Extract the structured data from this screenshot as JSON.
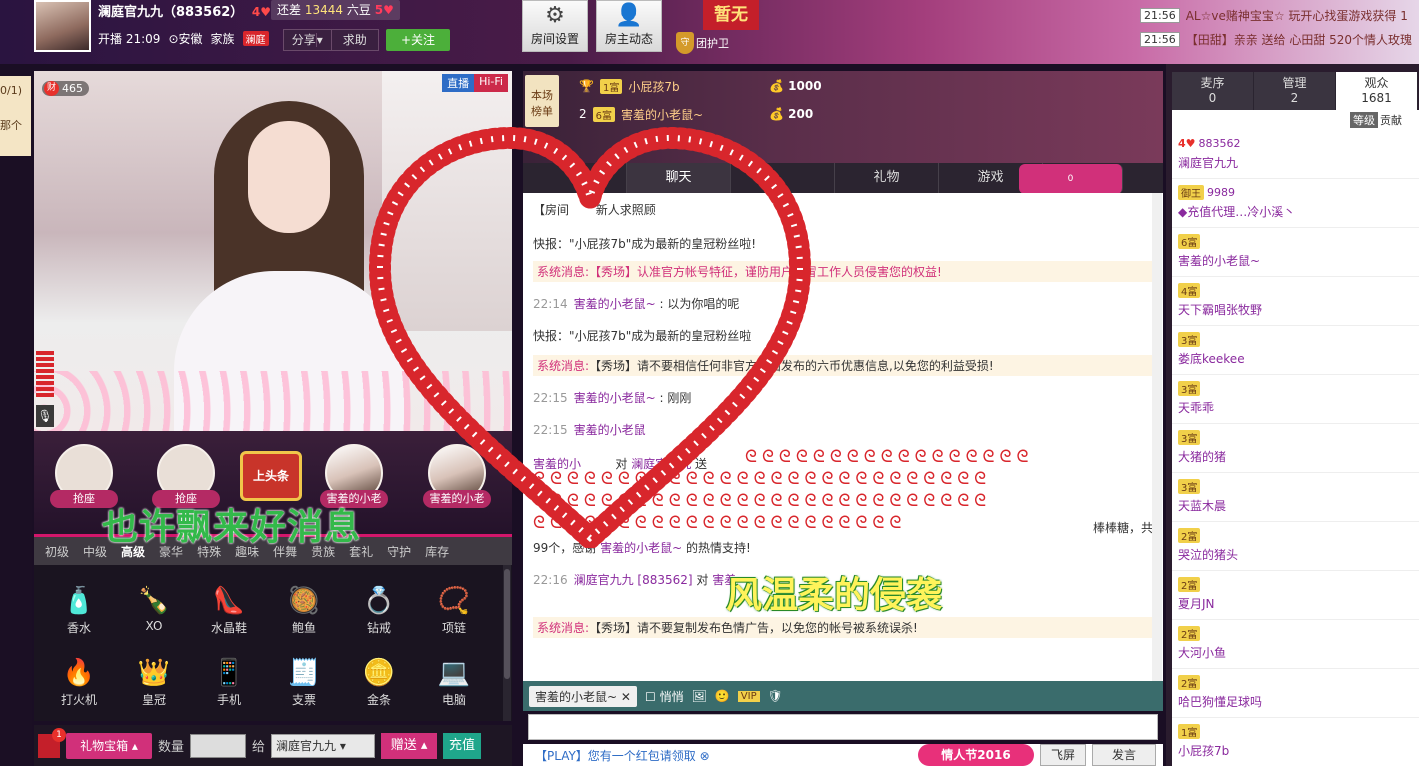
{
  "top": {
    "anchor_name": "澜庭官九九",
    "anchor_id": "（883562）",
    "anchor_level": "4",
    "gap_label": "还差",
    "gap_value": "13444",
    "gap_unit": "六豆",
    "next_level": "5",
    "start_label": "开播",
    "start_time": "21:09",
    "location": "安徽",
    "family_label": "家族",
    "family_tag": "澜庭",
    "share_label": "分享",
    "help_label": "求助",
    "follow_label": "+关注",
    "room_settings_label": "房间设置",
    "host_updates_label": "房主动态",
    "guard_label": "团护卫",
    "guard_badge": "守",
    "none_label": "暂无"
  },
  "notices": [
    {
      "time": "21:56",
      "text": "AL☆ve赌神宝宝☆ 玩开心找蛋游戏获得 1"
    },
    {
      "time": "21:56",
      "text": "【田甜】亲亲 送给 心田甜 520个情人玫瑰"
    }
  ],
  "left_tab": {
    "text1": "0/1)",
    "text2": "那个"
  },
  "video": {
    "wealth_icon": "财",
    "count": "465",
    "tag_live": "直播",
    "tag_hifi": "Hi-Fi"
  },
  "seats": [
    {
      "label": "抢座"
    },
    {
      "label": "抢座"
    },
    {
      "label": "害羞的小老"
    },
    {
      "label": "害羞的小老"
    }
  ],
  "headline_label": "上头条",
  "overlay_green": "也许飘来好消息",
  "overlay_yellow": "风温柔的侵袭",
  "gift_tabs": [
    "初级",
    "中级",
    "高级",
    "豪华",
    "特殊",
    "趣味",
    "伴舞",
    "贵族",
    "套礼",
    "守护",
    "库存"
  ],
  "gifts": [
    {
      "icon": "perfume-icon",
      "glyph": "🧴",
      "label": "香水"
    },
    {
      "icon": "xo-bottle-icon",
      "glyph": "🍾",
      "label": "XO"
    },
    {
      "icon": "crystal-shoe-icon",
      "glyph": "👠",
      "label": "水晶鞋"
    },
    {
      "icon": "abalone-icon",
      "glyph": "🥘",
      "label": "鲍鱼"
    },
    {
      "icon": "diamond-ring-icon",
      "glyph": "💍",
      "label": "钻戒"
    },
    {
      "icon": "necklace-icon",
      "glyph": "📿",
      "label": "项链"
    },
    {
      "icon": "lighter-icon",
      "glyph": "🔥",
      "label": "打火机"
    },
    {
      "icon": "crown-icon",
      "glyph": "👑",
      "label": "皇冠"
    },
    {
      "icon": "phone-icon",
      "glyph": "📱",
      "label": "手机"
    },
    {
      "icon": "check-icon",
      "glyph": "🧾",
      "label": "支票"
    },
    {
      "icon": "gold-bar-icon",
      "glyph": "🪙",
      "label": "金条"
    },
    {
      "icon": "laptop-icon",
      "glyph": "💻",
      "label": "电脑"
    }
  ],
  "gift_bottom": {
    "badge": "1",
    "box_label": "礼物宝箱",
    "qty_label": "数量",
    "to_label": "给",
    "to_value": "澜庭官九九",
    "send_label": "赠送",
    "charge_label": "充值"
  },
  "rank": {
    "badge_line1": "本场",
    "badge_line2": "榜单",
    "rows": [
      {
        "pos": "1",
        "lvl": "1富",
        "name": "小屁孩7b",
        "amt": "1000"
      },
      {
        "pos": "2",
        "lvl": "6富",
        "name": "害羞的小老鼠~",
        "amt": "200"
      }
    ]
  },
  "chat_tabs": [
    "",
    "聊天",
    "",
    "礼物",
    "游戏"
  ],
  "car_badge": "0",
  "chat": {
    "m1_prefix": "【房间",
    "m1_text": "新人求照顾",
    "m2": "快报：\"小屁孩7b\"成为最新的皇冠粉丝啦!",
    "m3_label": "系统消息:",
    "m3_text": "【秀场】认准官方帐号特征，谨防用户假冒工作人员侵害您的权益!",
    "m4_time": "22:14",
    "m4_user": "害羞的小老鼠~",
    "m4_text": "以为你唱的呢",
    "m5": "快报：\"小屁孩7b\"成为最新的皇冠粉丝啦",
    "m6_label": "系统消息:",
    "m6_text": "【秀场】请不要相信任何非官方页面发布的六币优惠信息,以免您的利益受损!",
    "m7_time": "22:15",
    "m7_user": "害羞的小老鼠~",
    "m7_text": "刚刚",
    "m8_time": "22:15",
    "m8_user": "害羞的小老鼠",
    "m9_user": "害羞的小",
    "m9_mid": "对",
    "m9_user2": "澜庭官九九",
    "m9_send": "送",
    "m10_tail": "棒棒糖，共",
    "m11_pre": "99个，感谢",
    "m11_user": "害羞的小老鼠~",
    "m11_post": "的热情支持!",
    "m12_time": "22:16",
    "m12_user": "澜庭官九九 [883562]",
    "m12_mid": "对",
    "m12_user2": "害羞",
    "m13_label": "系统消息:",
    "m13_text": "【秀场】请不要复制发布色情广告，以免您的帐号被系统误杀!"
  },
  "input_bar": {
    "to_chip": "害羞的小老鼠~",
    "private_label": "悄悄",
    "vip_label": "VIP"
  },
  "bottom": {
    "play_text": "【PLAY】您有一个红包请领取",
    "valentine": "情人节2016",
    "fly_label": "飞屏",
    "speak_label": "发言"
  },
  "viewer_tabs": [
    {
      "label": "麦序",
      "count": "0"
    },
    {
      "label": "管理",
      "count": "2"
    },
    {
      "label": "观众",
      "count": "1681"
    }
  ],
  "viewer_sub": {
    "level": "等级",
    "contrib": "贡献"
  },
  "viewers": [
    {
      "badge": "4♥",
      "extra": "883562",
      "name": "澜庭官九九"
    },
    {
      "badge": "御王",
      "extra": "9989",
      "name": "◆充值代理…冷小溪丶"
    },
    {
      "badge": "6富",
      "extra": "",
      "name": "害羞的小老鼠~"
    },
    {
      "badge": "4富",
      "extra": "",
      "name": "天下霸唱张牧野"
    },
    {
      "badge": "3富",
      "extra": "",
      "name": "娄底keekee"
    },
    {
      "badge": "3富",
      "extra": "",
      "name": "天乖乖"
    },
    {
      "badge": "3富",
      "extra": "",
      "name": "大猪的猪"
    },
    {
      "badge": "3富",
      "extra": "",
      "name": "天蓝木晨"
    },
    {
      "badge": "2富",
      "extra": "",
      "name": "哭泣的猪头"
    },
    {
      "badge": "2富",
      "extra": "",
      "name": "夏月JN"
    },
    {
      "badge": "2富",
      "extra": "",
      "name": "大河小鱼"
    },
    {
      "badge": "2富",
      "extra": "",
      "name": "哈巴狗懂足球吗"
    },
    {
      "badge": "1富",
      "extra": "",
      "name": "小屁孩7b"
    }
  ]
}
